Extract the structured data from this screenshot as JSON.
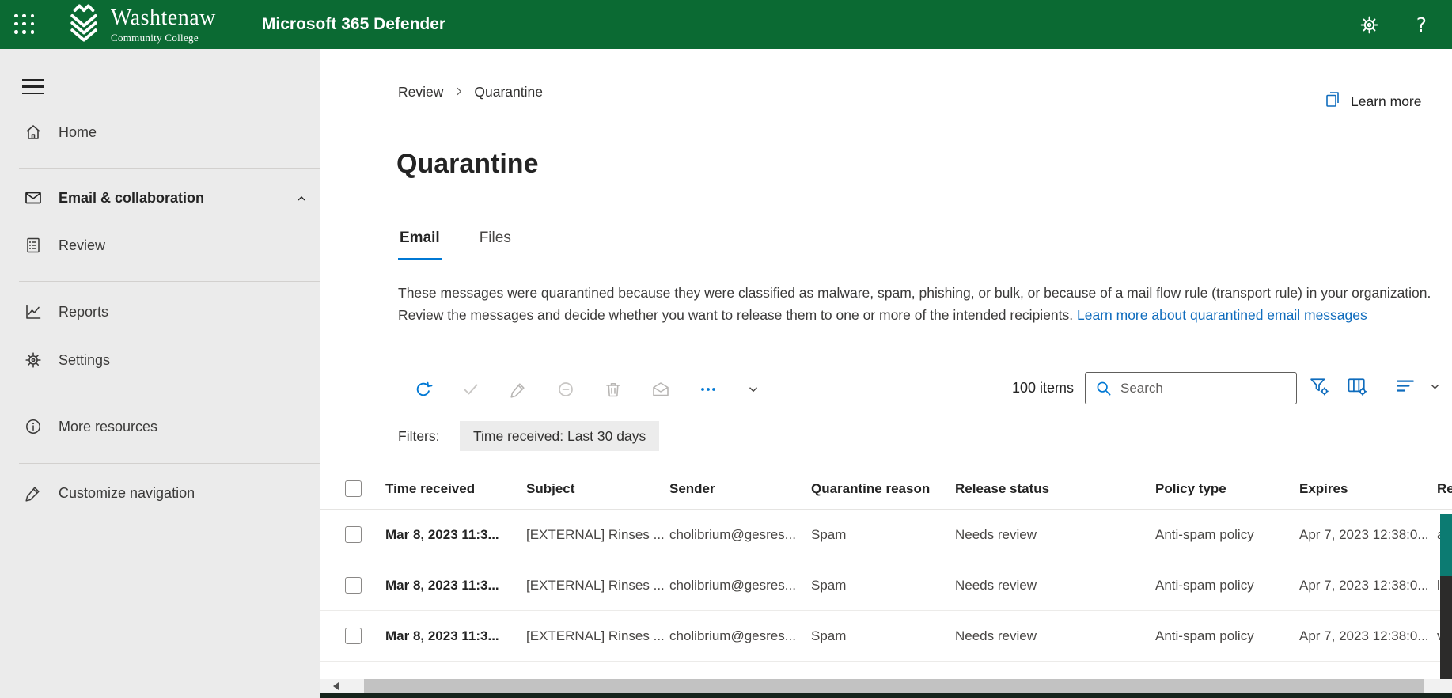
{
  "header": {
    "app_title": "Microsoft 365 Defender",
    "org_name": "Washtenaw",
    "org_subname": "Community College"
  },
  "sidebar": {
    "items": [
      {
        "label": "Home",
        "icon": "home"
      },
      {
        "label": "Email & collaboration",
        "icon": "mail",
        "expanded": true
      },
      {
        "label": "Review",
        "icon": "document-list"
      },
      {
        "label": "Reports",
        "icon": "line-chart"
      },
      {
        "label": "Settings",
        "icon": "gear"
      },
      {
        "label": "More resources",
        "icon": "info-circle"
      },
      {
        "label": "Customize navigation",
        "icon": "pencil"
      }
    ]
  },
  "breadcrumb": {
    "parent": "Review",
    "current": "Quarantine"
  },
  "page": {
    "learn_more_label": "Learn more",
    "title": "Quarantine",
    "tabs": [
      {
        "label": "Email",
        "active": true
      },
      {
        "label": "Files",
        "active": false
      }
    ],
    "description": "These messages were quarantined because they were classified as malware, spam, phishing, or bulk, or because of a mail flow rule (transport rule) in your organization. Review the messages and decide whether you want to release them to one or more of the intended recipients. ",
    "description_link": "Learn more about quarantined email messages"
  },
  "toolbar": {
    "items_count": "100 items",
    "search_placeholder": "Search",
    "filters_label": "Filters:",
    "filter_chip": "Time received: Last 30 days",
    "icons": [
      "refresh",
      "check",
      "pencil",
      "block",
      "trash",
      "envelope",
      "ellipsis",
      "chevron-down"
    ],
    "right_icons": [
      "funnel-gear",
      "table-columns-gear",
      "group-lines",
      "chevron-down"
    ]
  },
  "table": {
    "columns": [
      "Time received",
      "Subject",
      "Sender",
      "Quarantine reason",
      "Release status",
      "Policy type",
      "Expires",
      "Re"
    ],
    "rows": [
      {
        "time": "Mar 8, 2023 11:3...",
        "subject": "[EXTERNAL] Rinses ...",
        "sender": "cholibrium@gesres...",
        "reason": "Spam",
        "release": "Needs review",
        "policy": "Anti-spam policy",
        "expires": "Apr 7, 2023 12:38:0...",
        "recipient": "a"
      },
      {
        "time": "Mar 8, 2023 11:3...",
        "subject": "[EXTERNAL] Rinses ...",
        "sender": "cholibrium@gesres...",
        "reason": "Spam",
        "release": "Needs review",
        "policy": "Anti-spam policy",
        "expires": "Apr 7, 2023 12:38:0...",
        "recipient": "l"
      },
      {
        "time": "Mar 8, 2023 11:3...",
        "subject": "[EXTERNAL] Rinses ...",
        "sender": "cholibrium@gesres...",
        "reason": "Spam",
        "release": "Needs review",
        "policy": "Anti-spam policy",
        "expires": "Apr 7, 2023 12:38:0...",
        "recipient": "vi"
      }
    ]
  },
  "colors": {
    "header_green": "#0b6a33",
    "accent_blue": "#0078d4",
    "link_blue": "#0f6cbd",
    "sidebar_bg": "#ebebeb",
    "chip_bg": "#ececec",
    "teal_strip": "#0c7b72",
    "dark_strip": "#2c2b2a",
    "bottom_bar": "#16241c"
  }
}
